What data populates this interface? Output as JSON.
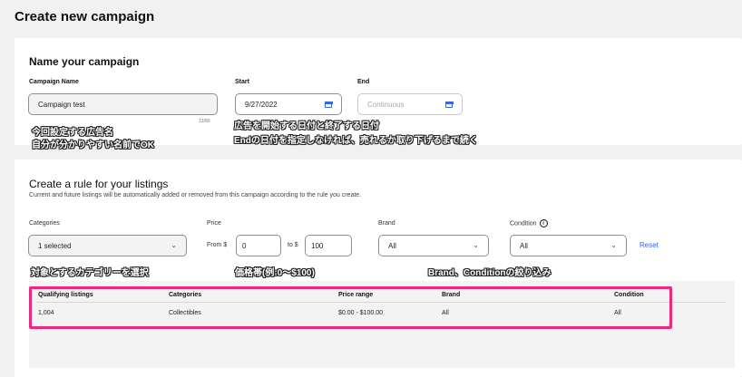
{
  "page": {
    "title": "Create new campaign"
  },
  "name_section": {
    "title": "Name your campaign",
    "campaign_name_label": "Campaign Name",
    "campaign_name_value": "Campaign test",
    "char_counter": "13/80",
    "start_label": "Start",
    "start_value": "9/27/2022",
    "end_label": "End",
    "end_placeholder": "Continuous"
  },
  "annotations": {
    "name_line1": "今回設定する広告名",
    "name_line2": "自分が分かりやすい名前でOK",
    "date_line1": "広告を開始する日付と終了する日付",
    "date_line2": "Endの日付を指定しなければ、売れるか取り下げるまで続く",
    "categories": "対象とするカテゴリーを選択",
    "price": "価格帯(例:0〜$100)",
    "brand_condition": "Brand、Conditionの絞り込み"
  },
  "rule_section": {
    "title": "Create a rule for your listings",
    "description": "Current and future listings will be automatically added or removed from this campaign according to the rule you create.",
    "categories_label": "Categories",
    "categories_value": "1 selected",
    "price_label": "Price",
    "from_label": "From $",
    "from_value": "0",
    "to_label": "to $",
    "to_value": "100",
    "brand_label": "Brand",
    "brand_value": "All",
    "condition_label": "Condition",
    "condition_value": "All",
    "reset_label": "Reset"
  },
  "table": {
    "headers": [
      "Qualifying listings",
      "Categories",
      "Price range",
      "Brand",
      "Condition"
    ],
    "row": [
      "1,004",
      "Collectibles",
      "$0.00 - $100.00",
      "All",
      "All"
    ]
  },
  "colors": {
    "accent": "#3665f3",
    "highlight": "#f0287d"
  }
}
